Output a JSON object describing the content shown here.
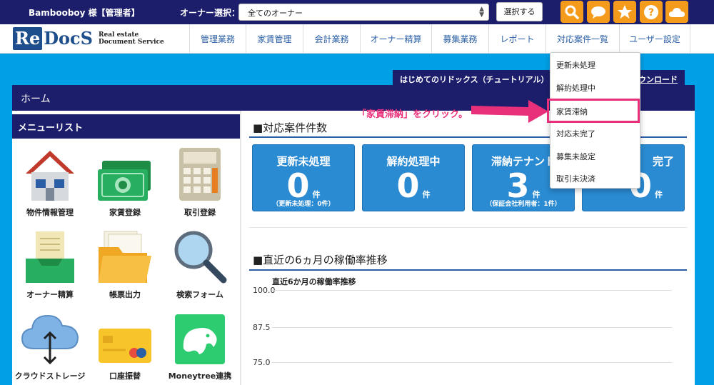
{
  "topbar": {
    "user": "Bambooboy 様【管理者】",
    "owner_label": "オーナー選択：",
    "owner_value": "全てのオーナー",
    "select_button": "選択する",
    "tools": [
      "search-icon",
      "chat-icon",
      "star-icon",
      "help-icon",
      "cloud-icon"
    ],
    "tool_color": "#f59b1c"
  },
  "logo": {
    "re": "Re",
    "docs": "DocS",
    "tag1": "Real estate",
    "tag2": "Document Service"
  },
  "nav": [
    "管理業務",
    "家賃管理",
    "会計業務",
    "オーナー精算",
    "募集業務",
    "レポート",
    "対応案件一覧",
    "ユーザー設定"
  ],
  "tutorial": {
    "label": "はじめてのリドックス（チュートリアル）",
    "download": "ウンロード"
  },
  "home": {
    "title": "ホーム"
  },
  "menu": {
    "title": "メニューリスト",
    "items": [
      "物件情報管理",
      "家賃登録",
      "取引登録",
      "オーナー精算",
      "帳票出力",
      "検索フォーム",
      "クラウドストレージ",
      "口座振替",
      "Moneytree連携"
    ]
  },
  "summary": {
    "title": "■対応案件件数",
    "cards": [
      {
        "title": "更新未処理",
        "value": "0",
        "unit": "件",
        "sub": "（更新未処理：0件）"
      },
      {
        "title": "解約処理中",
        "value": "0",
        "unit": "件",
        "sub": ""
      },
      {
        "title": "滞納テナント",
        "value": "3",
        "unit": "件",
        "sub": "（保証会社利用者：1件）"
      },
      {
        "title": "完了",
        "value": "0",
        "unit": "件",
        "sub": ""
      }
    ]
  },
  "occupancy": {
    "title": "■直近の6ヵ月の稼働率推移",
    "chart_title": "直近6か月の稼働率推移",
    "ticks": [
      "100.0",
      "87.5",
      "75.0"
    ]
  },
  "dropdown": [
    "更新未処理",
    "解約処理中",
    "家賃滞納",
    "対応未完了",
    "募集未設定",
    "取引未決済"
  ],
  "annotation": "「家賃滞納」をクリック。",
  "colors": {
    "navy": "#1c1e6b",
    "sky": "#00a0e6",
    "card": "#2a8ad2",
    "accent": "#e8307a"
  }
}
